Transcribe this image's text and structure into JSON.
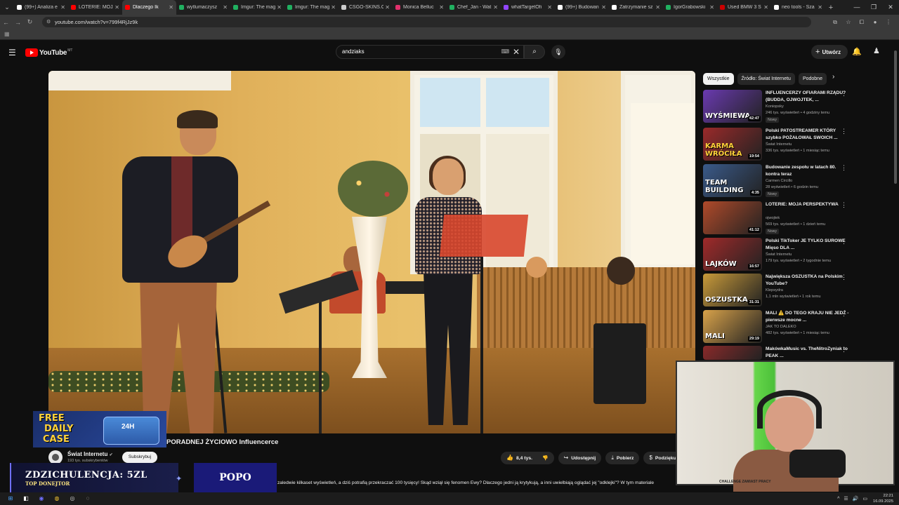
{
  "browser": {
    "tabs": [
      {
        "title": "(99+) Analiza e",
        "color": "#ffffff",
        "active": false
      },
      {
        "title": "LOTERIE: MOJA",
        "color": "#ff0000",
        "active": false
      },
      {
        "title": "Dlaczego Ik",
        "color": "#ff0000",
        "active": true
      },
      {
        "title": "wytlumaczysz",
        "color": "#20b060",
        "active": false
      },
      {
        "title": "Imgur: The mag",
        "color": "#20b060",
        "active": false
      },
      {
        "title": "Imgur: The mag",
        "color": "#20b060",
        "active": false
      },
      {
        "title": "CSGO-SKINS.C",
        "color": "#cccccc",
        "active": false
      },
      {
        "title": "Monica Belluc",
        "color": "#e1306c",
        "active": false
      },
      {
        "title": "Chef_Jan - Wat",
        "color": "#20b060",
        "active": false
      },
      {
        "title": "whatTargetOfi",
        "color": "#9146ff",
        "active": false
      },
      {
        "title": "(99+) Budowan",
        "color": "#ffffff",
        "active": false
      },
      {
        "title": "Zatrzymanie sz",
        "color": "#ffffff",
        "active": false
      },
      {
        "title": "IgorGrabowski",
        "color": "#20b060",
        "active": false
      },
      {
        "title": "Used BMW 3 S",
        "color": "#cc0000",
        "active": false
      },
      {
        "title": "neo tools - Sza",
        "color": "#ffffff",
        "active": false
      }
    ],
    "url": "youtube.com/watch?v=799f4RjJz9k"
  },
  "header": {
    "logo_text": "YouTube",
    "logo_country": "MT",
    "search_value": "andziaks",
    "create_label": "Utwórz"
  },
  "filters": [
    "Wszystkie",
    "Źródło: Świat Internetu",
    "Podobne"
  ],
  "recommendations": [
    {
      "title": "INFLUENCERZY OFIARAMI RZĄDU? (BUDDA, OJWOJTEK, ...",
      "channel": "Koniopsky",
      "meta": "246 tys. wyświetleń • 4 godziny temu",
      "badge": "Nowy",
      "duration": "42:47",
      "thumb_text": "WYŚMIEWA",
      "thumb_color": "#6a3ab0"
    },
    {
      "title": "Polski PATOSTREAMER KTÓRY szybko POŻAŁOWAŁ SWOICH ...",
      "channel": "Świat Internetu",
      "meta": "336 tys. wyświetleń • 1 miesiąc temu",
      "badge": "",
      "duration": "19:54",
      "thumb_text": "KARMA WRÓCIŁA",
      "thumb_color": "#9a2a2a"
    },
    {
      "title": "Budowanie zespołu w latach 80. kontra teraz",
      "channel": "Carmen Circillo",
      "meta": "28 wyświetleń • 6 godzin temu",
      "badge": "Nowy",
      "duration": "4:35",
      "thumb_text": "TEAM BUILDING",
      "thumb_color": "#3a5a8a"
    },
    {
      "title": "LOTERIE: MOJA PERSPEKTYWA",
      "channel": "ojwojtek",
      "meta": "569 tys. wyświetleń • 1 dzień temu",
      "badge": "Nowy",
      "duration": "41:12",
      "thumb_text": "",
      "thumb_color": "#b04a2a"
    },
    {
      "title": "Polski TikToker JE TYLKO SUROWE Mięso DLA ...",
      "channel": "Świat Internetu",
      "meta": "179 tys. wyświetleń • 2 tygodnie temu",
      "badge": "",
      "duration": "16:57",
      "thumb_text": "LAJKÓW",
      "thumb_color": "#a02a2a"
    },
    {
      "title": "Największa OSZUSTKA na Polskim YouTube?",
      "channel": "Klepsydra",
      "meta": "1,1 mln wyświetleń • 1 rok temu",
      "badge": "",
      "duration": "31:31",
      "thumb_text": "OSZUSTKA",
      "thumb_color": "#c89a3a"
    },
    {
      "title": "MALI ⚠️ DO TEGO KRAJU NIE JEDŹ - pierwsze mocne ...",
      "channel": "JAK TO DALEKO",
      "meta": "482 tys. wyświetleń • 1 miesiąc temu",
      "badge": "",
      "duration": "29:19",
      "thumb_text": "MALI",
      "thumb_color": "#d8a24a"
    },
    {
      "title": "MakówkaMusic vs. TheNitroZyniak to PEAK ...",
      "channel": "",
      "meta": "",
      "badge": "",
      "duration": "",
      "thumb_text": "",
      "thumb_color": "#8a2a2a"
    }
  ],
  "video": {
    "title_visible": "PORADNEJ ŻYCIOWO Influencerce",
    "channel": "Świat Internetu",
    "subs": "193 tys. subskrybentów",
    "subscribe_label": "Subskrybuj",
    "likes": "8,4 tys.",
    "share_label": "Udostępnij",
    "download_label": "Pobierz",
    "thanks_label": "Podziękuj",
    "description_line": "zaledwie kilkaset wyświetleń, a dziś potrafią przekraczać 100 tysięcy! Skąd wziął się fenomen Ewy? Dlaczego jedni ją krytykują, a inni uwielbiają oglądać jej \"odklejki\"? W tym materiale"
  },
  "stream_overlay": {
    "free_case_lines": [
      "FREE",
      "DAILY",
      "CASE"
    ],
    "free_case_box": "24H",
    "donor_name": "ZDZICHULENCJA: 5ZL",
    "donor_label": "TOP DONEJTOR",
    "popo": "POPO",
    "cam_sign": "CHALLENGE ZAMIAST PRACY"
  },
  "taskbar": {
    "time": "22:21",
    "date": "16.09.2025"
  }
}
